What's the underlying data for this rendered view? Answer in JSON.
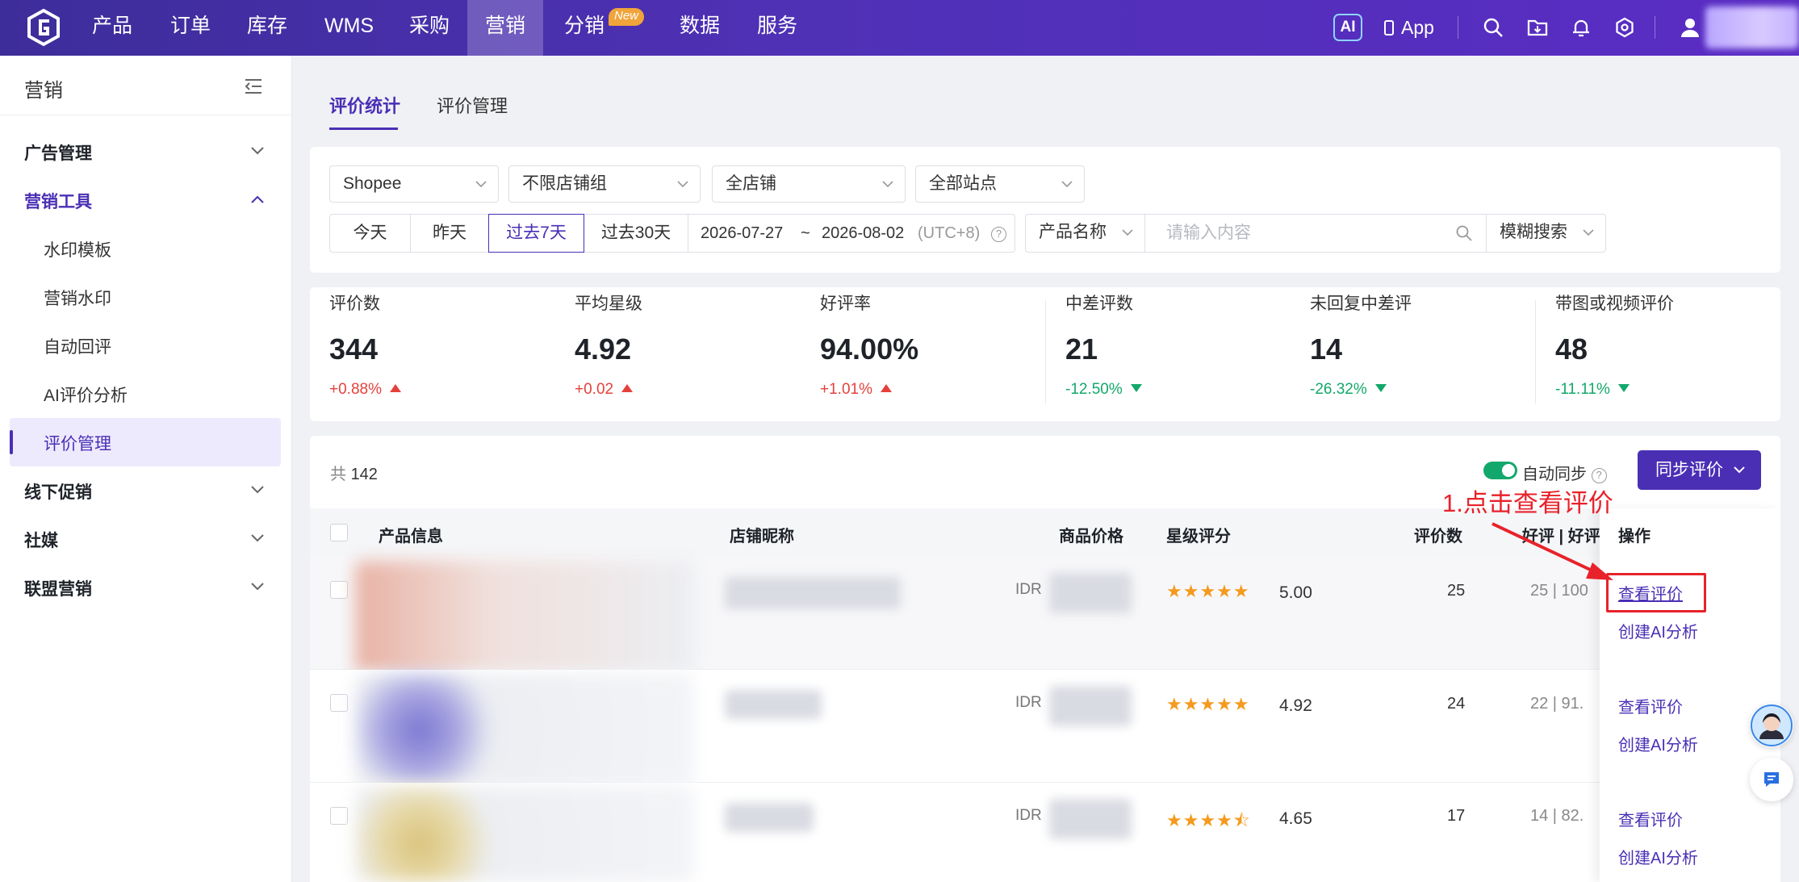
{
  "nav": {
    "items": [
      {
        "label": "产品"
      },
      {
        "label": "订单"
      },
      {
        "label": "库存"
      },
      {
        "label": "WMS"
      },
      {
        "label": "采购"
      },
      {
        "label": "营销"
      },
      {
        "label": "分销"
      },
      {
        "label": "数据"
      },
      {
        "label": "服务"
      }
    ],
    "active": "营销",
    "new_badge": "New",
    "ai_badge": "AI",
    "app_label": "App",
    "icons": [
      "search-icon",
      "folder-download-icon",
      "bell-icon",
      "gear-icon",
      "user-icon"
    ]
  },
  "sidebar": {
    "title": "营销",
    "groups": [
      {
        "label": "广告管理",
        "open": false
      },
      {
        "label": "营销工具",
        "open": true
      },
      {
        "label": "线下促销",
        "open": false
      },
      {
        "label": "社媒",
        "open": false
      },
      {
        "label": "联盟营销",
        "open": false
      }
    ],
    "sub_items": [
      {
        "label": "水印模板"
      },
      {
        "label": "营销水印"
      },
      {
        "label": "自动回评"
      },
      {
        "label": "AI评价分析"
      },
      {
        "label": "评价管理"
      }
    ],
    "active_sub": "评价管理"
  },
  "tabs": [
    {
      "label": "评价统计"
    },
    {
      "label": "评价管理"
    }
  ],
  "filters": {
    "platform": "Shopee",
    "shop_group": "不限店铺组",
    "shop": "全店铺",
    "site": "全部站点",
    "periods": [
      {
        "label": "今天"
      },
      {
        "label": "昨天"
      },
      {
        "label": "过去7天"
      },
      {
        "label": "过去30天"
      }
    ],
    "active_period": "过去7天",
    "date_start": "2026-07-27",
    "date_sep": "~",
    "date_end": "2026-08-02",
    "timezone": "(UTC+8)",
    "search_field": "产品名称",
    "search_placeholder": "请输入内容",
    "search_mode": "模糊搜索"
  },
  "stats": [
    {
      "label": "评价数",
      "value": "344",
      "delta": "+0.88%",
      "trend": "up"
    },
    {
      "label": "平均星级",
      "value": "4.92",
      "delta": "+0.02",
      "trend": "up"
    },
    {
      "label": "好评率",
      "value": "94.00%",
      "delta": "+1.01%",
      "trend": "up"
    },
    {
      "label": "中差评数",
      "value": "21",
      "delta": "-12.50%",
      "trend": "down"
    },
    {
      "label": "未回复中差评",
      "value": "14",
      "delta": "-26.32%",
      "trend": "down"
    },
    {
      "label": "带图或视频评价",
      "value": "48",
      "delta": "-11.11%",
      "trend": "down"
    }
  ],
  "table": {
    "total_label": "共",
    "total": "142",
    "auto_sync_label": "自动同步",
    "auto_sync_on": true,
    "sync_button": "同步评价",
    "columns": {
      "product": "产品信息",
      "shop": "店铺昵称",
      "price": "商品价格",
      "stars": "星级评分",
      "count": "评价数",
      "good": "好评 | 好评",
      "actions": "操作"
    },
    "rows": [
      {
        "currency": "IDR",
        "stars": "★★★★★",
        "rating": "5.00",
        "count": "25",
        "good": "25 | 100",
        "star_value": 5.0
      },
      {
        "currency": "IDR",
        "stars": "★★★★★",
        "rating": "4.92",
        "count": "24",
        "good": "22 | 91.",
        "star_value": 4.92
      },
      {
        "currency": "IDR",
        "stars": "★★★★⯪",
        "rating": "4.65",
        "count": "17",
        "good": "14 | 82.",
        "star_value": 4.65
      }
    ],
    "action_view": "查看评价",
    "action_ai": "创建AI分析"
  },
  "annotation": "1.点击查看评价",
  "colors": {
    "brand": "#4a2fb5",
    "up": "#e5413c",
    "down": "#13a86b",
    "star": "#f59a1e",
    "annotation": "#e8222a"
  }
}
